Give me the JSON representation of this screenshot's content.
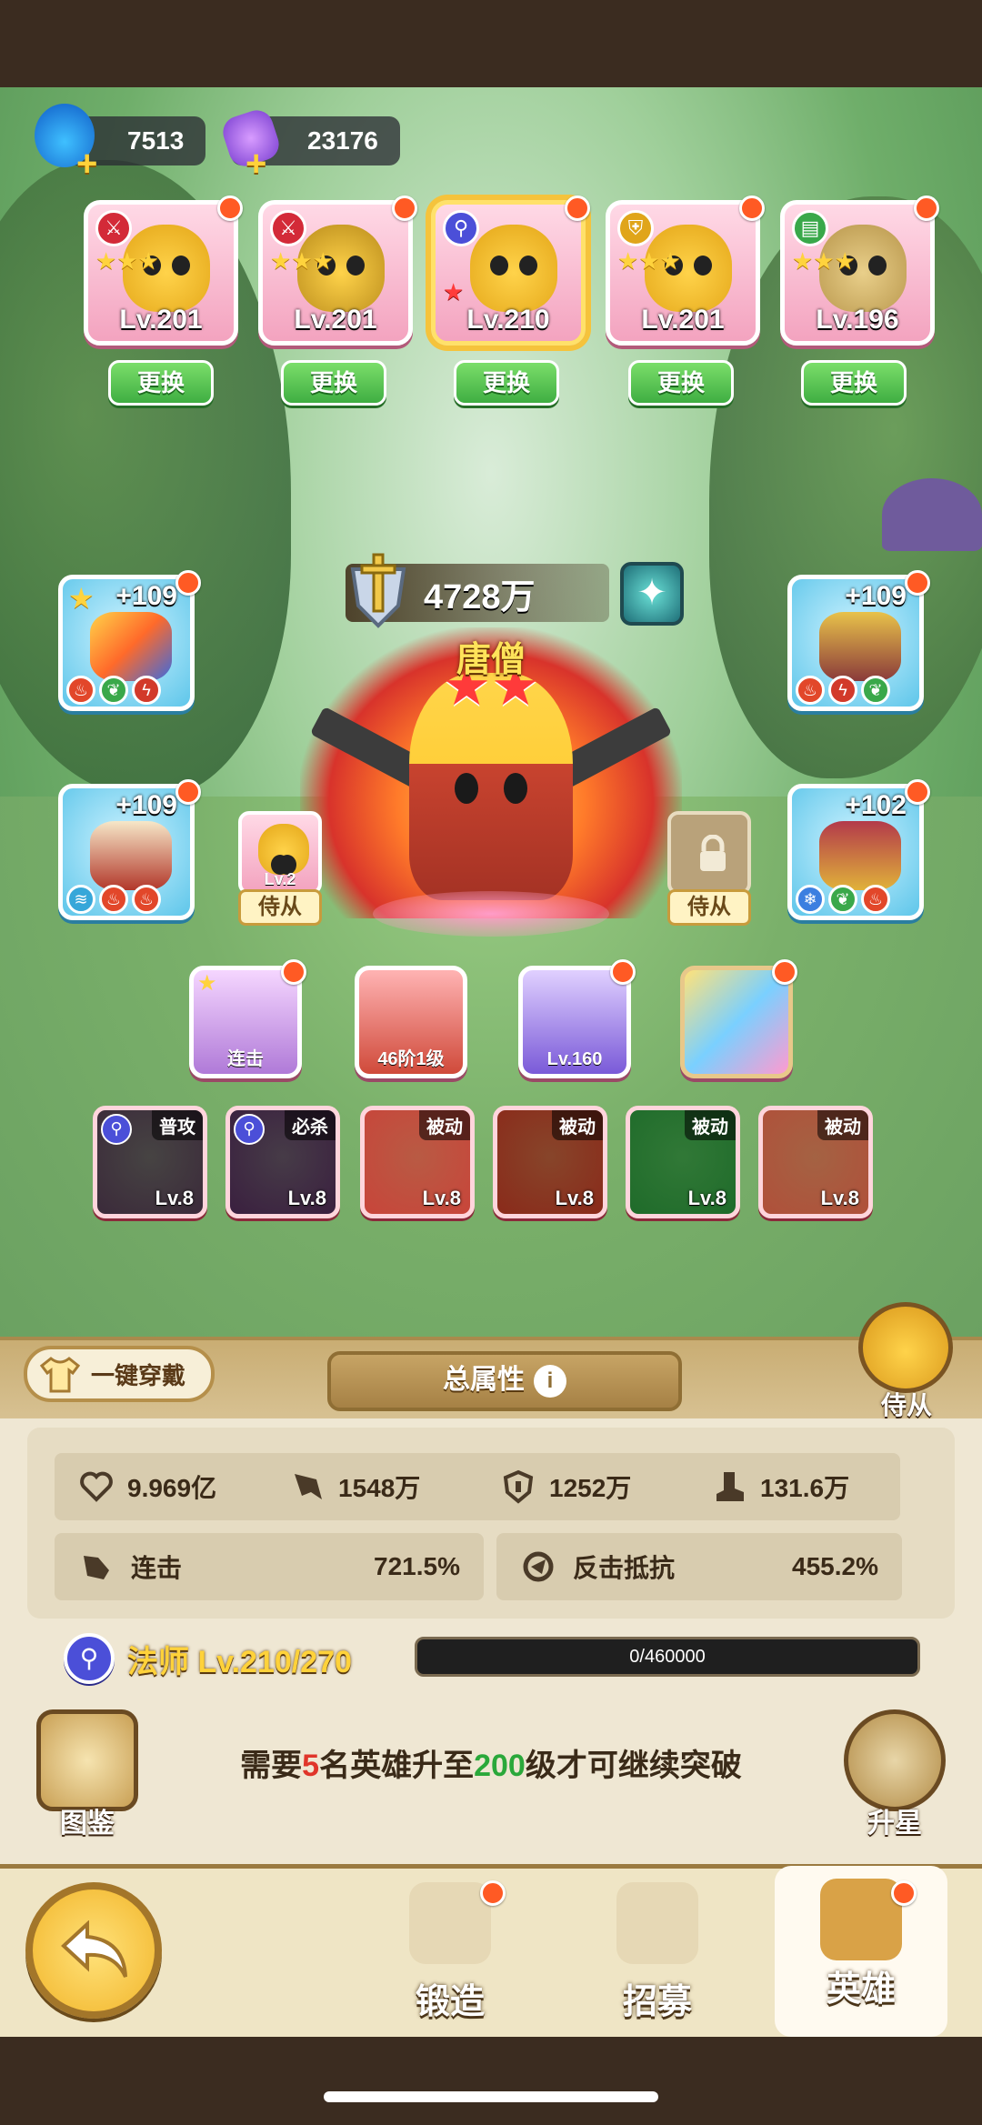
{
  "currencies": [
    {
      "icon": "blue-flame-icon",
      "value": "7513"
    },
    {
      "icon": "purple-crystal-icon",
      "value": "23176"
    }
  ],
  "team": [
    {
      "level": "Lv.201",
      "class_icon": "sword-icon",
      "stars": "★★★",
      "star_color": "gold",
      "swap_label": "更换"
    },
    {
      "level": "Lv.201",
      "class_icon": "sword-icon",
      "stars": "★★★",
      "star_color": "gold",
      "swap_label": "更换"
    },
    {
      "level": "Lv.210",
      "class_icon": "staff-icon",
      "stars": "★",
      "star_color": "red",
      "swap_label": "更换",
      "selected": true
    },
    {
      "level": "Lv.201",
      "class_icon": "shield-icon",
      "stars": "★★★",
      "star_color": "gold",
      "swap_label": "更换"
    },
    {
      "level": "Lv.196",
      "class_icon": "book-icon",
      "stars": "★★★",
      "star_color": "gold",
      "swap_label": "更换"
    }
  ],
  "hero": {
    "power": "4728万",
    "name": "唐僧"
  },
  "equipment": {
    "left": [
      {
        "plus": "+109",
        "gems": [
          "fire",
          "leaf",
          "bolt"
        ]
      },
      {
        "plus": "+109",
        "gems": [
          "wind",
          "fire",
          "fire"
        ]
      }
    ],
    "right": [
      {
        "plus": "+109",
        "gems": [
          "fire",
          "bolt",
          "leaf"
        ]
      },
      {
        "plus": "+102",
        "gems": [
          "ice",
          "leaf",
          "fire"
        ]
      }
    ]
  },
  "followers": {
    "left": {
      "level": "Lv.2",
      "label": "侍从"
    },
    "right": {
      "label": "侍从",
      "locked": true
    }
  },
  "items": [
    {
      "label": "连击"
    },
    {
      "label": "46阶1级"
    },
    {
      "label": "Lv.160"
    },
    {
      "label": ""
    }
  ],
  "skills": [
    {
      "tag": "普攻",
      "level": "Lv.8",
      "color": "#3b2a3a"
    },
    {
      "tag": "必杀",
      "level": "Lv.8",
      "color": "#3a1f3f"
    },
    {
      "tag": "被动",
      "level": "Lv.8",
      "color": "#c8453a"
    },
    {
      "tag": "被动",
      "level": "Lv.8",
      "color": "#8a2a1a"
    },
    {
      "tag": "被动",
      "level": "Lv.8",
      "color": "#1f6b2a"
    },
    {
      "tag": "被动",
      "level": "Lv.8",
      "color": "#b0503a"
    }
  ],
  "panel": {
    "one_click": "一键穿戴",
    "total_attr": "总属性",
    "follower_button": "侍从",
    "stats": [
      {
        "icon": "heart-icon",
        "value": "9.969亿"
      },
      {
        "icon": "attack-icon",
        "value": "1548万"
      },
      {
        "icon": "defense-icon",
        "value": "1252万"
      },
      {
        "icon": "speed-icon",
        "value": "131.6万"
      }
    ],
    "extra_stats": [
      {
        "icon": "combo-icon",
        "label": "连击",
        "value": "721.5%"
      },
      {
        "icon": "counter-resist-icon",
        "label": "反击抵抗",
        "value": "455.2%"
      }
    ],
    "class_label": "法师 Lv.210/270",
    "exp_text": "0/460000",
    "exp_progress": 0,
    "breakthrough_pre": "需要",
    "breakthrough_n1": "5",
    "breakthrough_mid": "名英雄升至",
    "breakthrough_n2": "200",
    "breakthrough_post": "级才可继续突破",
    "codex_label": "图鉴",
    "star_up_label": "升星"
  },
  "nav": {
    "forge": "锻造",
    "recruit": "招募",
    "hero": "英雄"
  }
}
